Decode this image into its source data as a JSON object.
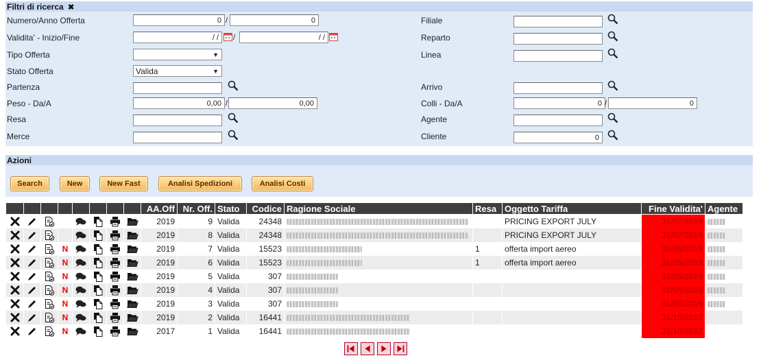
{
  "filters": {
    "title": "Filtri di ricerca",
    "close_glyph": "✖",
    "numero_label": "Numero/Anno Offerta",
    "numero_value": "0",
    "anno_value": "0",
    "validita_label": "Validita' - Inizio/Fine",
    "validita_start": "/ /",
    "validita_end": "/ /",
    "tipo_label": "Tipo Offerta",
    "tipo_value": "",
    "stato_label": "Stato Offerta",
    "stato_value": "Valida",
    "partenza_label": "Partenza",
    "peso_label": "Peso - Da/A",
    "peso_from": "0,00",
    "peso_to": "0,00",
    "resa_label": "Resa",
    "merce_label": "Merce",
    "filiale_label": "Filiale",
    "reparto_label": "Reparto",
    "linea_label": "Linea",
    "arrivo_label": "Arrivo",
    "colli_label": "Colli - Da/A",
    "colli_from": "0",
    "colli_to": "0",
    "agente_label": "Agente",
    "cliente_label": "Cliente",
    "cliente_value": "0"
  },
  "actions": {
    "title": "Azioni",
    "buttons": [
      "Search",
      "New",
      "New Fast",
      "Analisi Spedizioni",
      "Analisi Costi"
    ]
  },
  "table": {
    "headers": {
      "anno": "AA.Off",
      "nr": "Nr. Off.",
      "stato": "Stato",
      "codice": "Codice",
      "ragione": "Ragione Sociale",
      "resa": "Resa",
      "oggetto": "Oggetto Tariffa",
      "fine": "Fine Validita'",
      "agente": "Agente"
    },
    "rows": [
      {
        "n": false,
        "anno": "2019",
        "nr": "9",
        "stato": "Valida",
        "codice": "24348",
        "resa": "",
        "oggetto": "PRICING EXPORT JULY",
        "fine": "31/07/2019"
      },
      {
        "n": false,
        "anno": "2019",
        "nr": "8",
        "stato": "Valida",
        "codice": "24348",
        "resa": "",
        "oggetto": "PRICING EXPORT JULY",
        "fine": "31/07/2019"
      },
      {
        "n": true,
        "anno": "2019",
        "nr": "7",
        "stato": "Valida",
        "codice": "15523",
        "resa": "1",
        "oggetto": "offerta import aereo",
        "fine": "31/05/2019"
      },
      {
        "n": true,
        "anno": "2019",
        "nr": "6",
        "stato": "Valida",
        "codice": "15523",
        "resa": "1",
        "oggetto": "offerta import aereo",
        "fine": "31/05/2019"
      },
      {
        "n": true,
        "anno": "2019",
        "nr": "5",
        "stato": "Valida",
        "codice": "307",
        "resa": "",
        "oggetto": "",
        "fine": "31/05/2019"
      },
      {
        "n": true,
        "anno": "2019",
        "nr": "4",
        "stato": "Valida",
        "codice": "307",
        "resa": "",
        "oggetto": "",
        "fine": "31/05/2019"
      },
      {
        "n": true,
        "anno": "2019",
        "nr": "3",
        "stato": "Valida",
        "codice": "307",
        "resa": "",
        "oggetto": "",
        "fine": "31/05/2019"
      },
      {
        "n": true,
        "anno": "2019",
        "nr": "2",
        "stato": "Valida",
        "codice": "16441",
        "resa": "",
        "oggetto": "",
        "fine": "31/10/2017"
      },
      {
        "n": true,
        "anno": "2017",
        "nr": "1",
        "stato": "Valida",
        "codice": "16441",
        "resa": "",
        "oggetto": "",
        "fine": "31/10/2017"
      }
    ],
    "row_icons": [
      "delete-icon",
      "edit-pencil-icon",
      "document-check-icon",
      "new-n-badge",
      "comments-icon",
      "copy-icon",
      "print-icon",
      "folder-icon"
    ]
  },
  "pager": {
    "icons": [
      "first-page-icon",
      "previous-page-icon",
      "next-page-icon",
      "last-page-icon"
    ]
  },
  "colors": {
    "panel_header": "#c9d9f1",
    "panel_body": "#e1eaf7",
    "table_header": "#3e3e3e",
    "expired_cell": "#ff0000",
    "button": "#f6b85a"
  }
}
